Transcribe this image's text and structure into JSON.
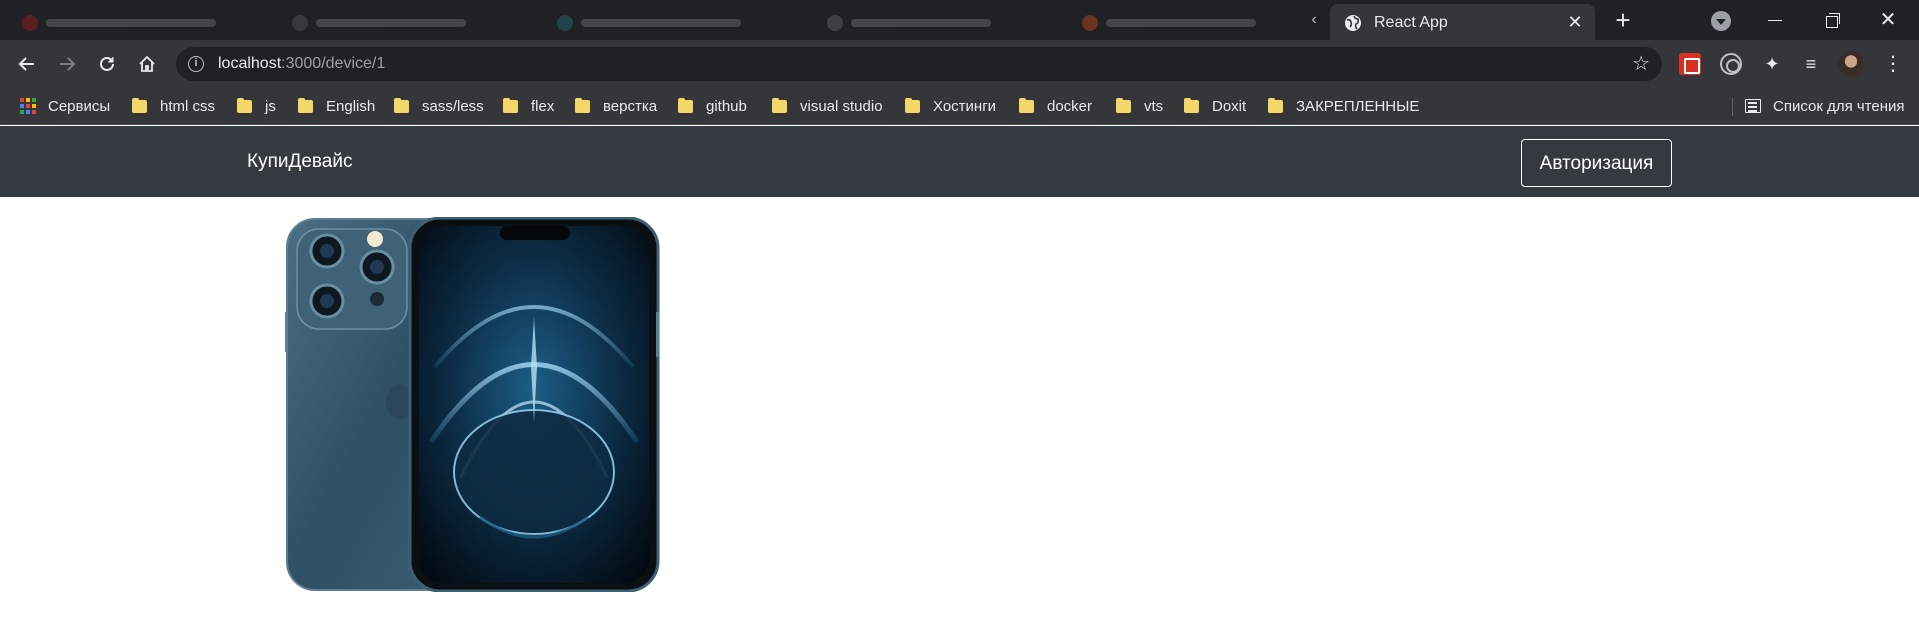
{
  "browser": {
    "active_tab": {
      "title": "React App",
      "close_icon": "close-icon",
      "favicon": "globe-icon"
    },
    "new_tab_label": "+",
    "scroll_left_label": "‹",
    "window_close_label": "✕",
    "address": {
      "host": "localhost",
      "path": ":3000/device/1"
    },
    "bookmarks": [
      {
        "label": "Сервисы",
        "icon": "apps-grid-icon"
      },
      {
        "label": "html css",
        "icon": "folder-icon"
      },
      {
        "label": "js",
        "icon": "folder-icon"
      },
      {
        "label": "English",
        "icon": "folder-icon"
      },
      {
        "label": "sass/less",
        "icon": "folder-icon"
      },
      {
        "label": "flex",
        "icon": "folder-icon"
      },
      {
        "label": "верстка",
        "icon": "folder-icon"
      },
      {
        "label": "github",
        "icon": "folder-icon"
      },
      {
        "label": "visual studio",
        "icon": "folder-icon"
      },
      {
        "label": "Хостинги",
        "icon": "folder-icon"
      },
      {
        "label": "docker",
        "icon": "folder-icon"
      },
      {
        "label": "vts",
        "icon": "folder-icon"
      },
      {
        "label": "Doxit",
        "icon": "folder-icon"
      },
      {
        "label": "ЗАКРЕПЛЕННЫЕ",
        "icon": "folder-icon"
      }
    ],
    "reading_list_label": "Список для чтения"
  },
  "navbar": {
    "brand": "КупиДевайс",
    "auth_button": "Авторизация",
    "background": "#343a40"
  },
  "device": {
    "image": "smartphone-image"
  },
  "colors": {
    "tabstrip": "#202124",
    "toolbar": "#35363a",
    "folder": "#f5d769",
    "phone_body": "#2f4f63"
  }
}
